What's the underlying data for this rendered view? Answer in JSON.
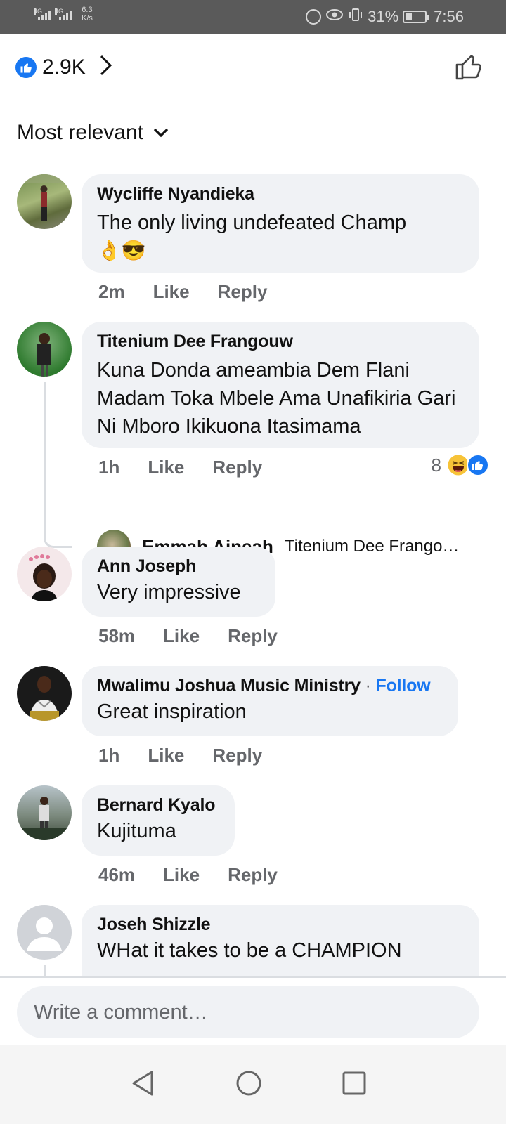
{
  "status_bar": {
    "network1": "4G",
    "network2": "4G",
    "speed_value": "6.3",
    "speed_unit": "K/s",
    "battery": "31%",
    "time": "7:56"
  },
  "header": {
    "reaction_count": "2.9K"
  },
  "sort": {
    "label": "Most relevant"
  },
  "comments": [
    {
      "name": "Wycliffe Nyandieka",
      "text": "The only living undefeated Champ",
      "emoji": "👌😎",
      "time": "2m",
      "like": "Like",
      "reply": "Reply"
    },
    {
      "name": "Titenium Dee Frangouw",
      "text": "Kuna Donda ameambia Dem Flani Madam Toka Mbele Ama Unafikiria Gari Ni Mboro Ikikuona Itasimama",
      "time": "1h",
      "like": "Like",
      "reply": "Reply",
      "reaction_count": "8",
      "reply_preview": {
        "name": "Emmah Aineah",
        "text": "Titenium Dee Frango…"
      }
    },
    {
      "name": "Ann Joseph",
      "text": "Very impressive",
      "time": "58m",
      "like": "Like",
      "reply": "Reply"
    },
    {
      "name": "Mwalimu Joshua Music Ministry",
      "follow": "Follow",
      "text": "Great inspiration",
      "time": "1h",
      "like": "Like",
      "reply": "Reply"
    },
    {
      "name": "Bernard Kyalo",
      "text": "Kujituma",
      "time": "46m",
      "like": "Like",
      "reply": "Reply"
    },
    {
      "name": "Joseh Shizzle",
      "text": "WHat it takes to be a CHAMPION"
    }
  ],
  "composer": {
    "placeholder": "Write a comment…"
  },
  "colors": {
    "accent": "#1877f2",
    "bubble": "#f0f2f5",
    "meta": "#65676b"
  }
}
